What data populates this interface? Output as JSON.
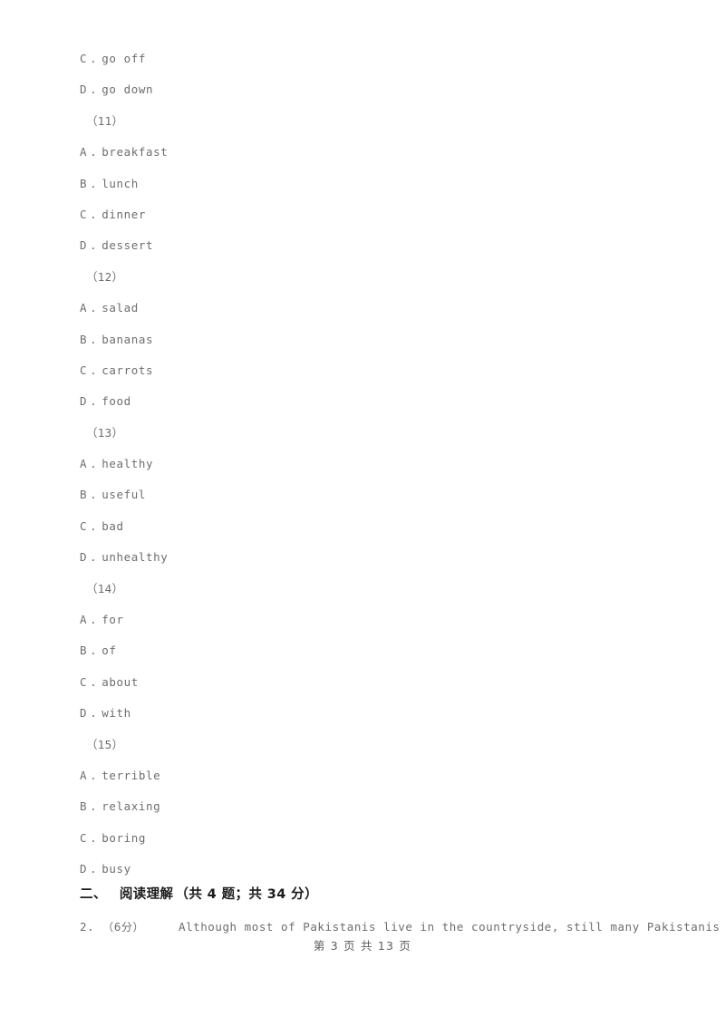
{
  "document": {
    "page_background": "#ffffff",
    "text_color": "#6e6e6e",
    "heading_color": "#1c1c1c"
  },
  "content_lines": [
    {
      "kind": "option",
      "letter": "C",
      "dot": ".",
      "text": "go off"
    },
    {
      "kind": "option",
      "letter": "D",
      "dot": ".",
      "text": "go down"
    },
    {
      "kind": "blank",
      "text": "（11）"
    },
    {
      "kind": "option",
      "letter": "A",
      "dot": ".",
      "text": "breakfast"
    },
    {
      "kind": "option",
      "letter": "B",
      "dot": ".",
      "text": "lunch"
    },
    {
      "kind": "option",
      "letter": "C",
      "dot": ".",
      "text": "dinner"
    },
    {
      "kind": "option",
      "letter": "D",
      "dot": ".",
      "text": "dessert"
    },
    {
      "kind": "blank",
      "text": "（12）"
    },
    {
      "kind": "option",
      "letter": "A",
      "dot": ".",
      "text": "salad"
    },
    {
      "kind": "option",
      "letter": "B",
      "dot": ".",
      "text": "bananas"
    },
    {
      "kind": "option",
      "letter": "C",
      "dot": ".",
      "text": "carrots"
    },
    {
      "kind": "option",
      "letter": "D",
      "dot": ".",
      "text": "food"
    },
    {
      "kind": "blank",
      "text": "（13）"
    },
    {
      "kind": "option",
      "letter": "A",
      "dot": ".",
      "text": "healthy"
    },
    {
      "kind": "option",
      "letter": "B",
      "dot": ".",
      "text": "useful"
    },
    {
      "kind": "option",
      "letter": "C",
      "dot": ".",
      "text": "bad"
    },
    {
      "kind": "option",
      "letter": "D",
      "dot": ".",
      "text": "unhealthy"
    },
    {
      "kind": "blank",
      "text": "（14）"
    },
    {
      "kind": "option",
      "letter": "A",
      "dot": ".",
      "text": "for"
    },
    {
      "kind": "option",
      "letter": "B",
      "dot": ".",
      "text": "of"
    },
    {
      "kind": "option",
      "letter": "C",
      "dot": ".",
      "text": "about"
    },
    {
      "kind": "option",
      "letter": "D",
      "dot": ".",
      "text": "with"
    },
    {
      "kind": "blank",
      "text": "（15）"
    },
    {
      "kind": "option",
      "letter": "A",
      "dot": ".",
      "text": "terrible"
    },
    {
      "kind": "option",
      "letter": "B",
      "dot": ".",
      "text": "relaxing"
    },
    {
      "kind": "option",
      "letter": "C",
      "dot": ".",
      "text": "boring"
    },
    {
      "kind": "option",
      "letter": "D",
      "dot": ".",
      "text": "busy"
    }
  ],
  "section_heading": {
    "number": "二、",
    "title": "阅读理解",
    "meta": "（共 4 题；共 34 分）"
  },
  "question": {
    "number": "2.",
    "score": "（6分）",
    "text": "Although most of Pakistanis live in the countryside, still many Pakistanis live"
  },
  "footer": {
    "text": "第 3 页 共 13 页"
  }
}
